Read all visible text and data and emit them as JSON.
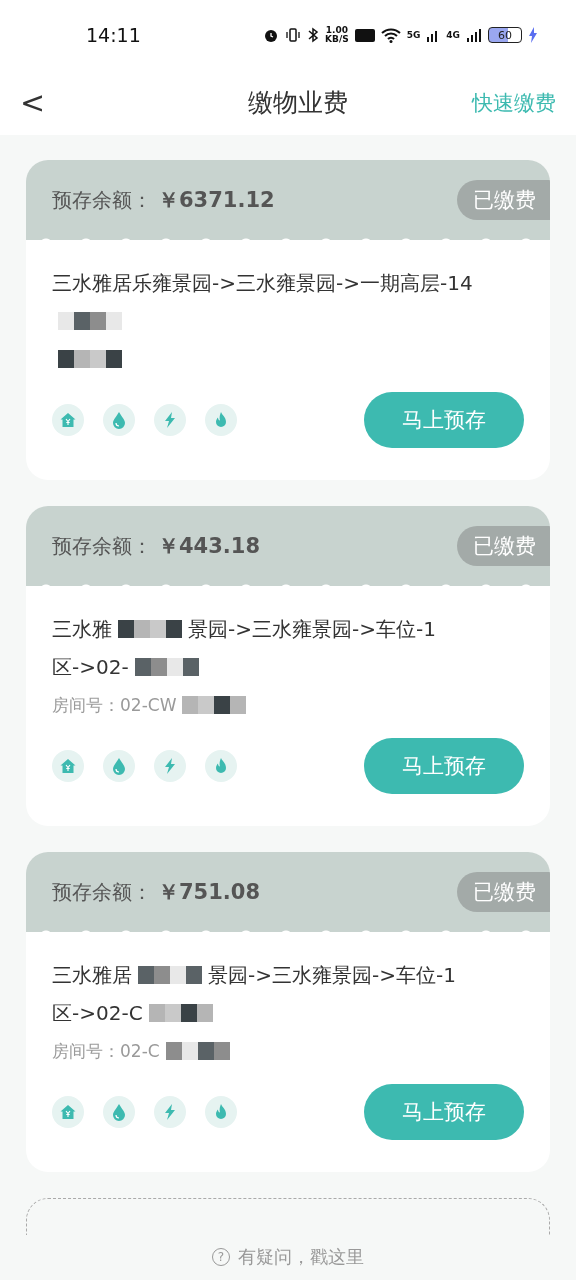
{
  "status_bar": {
    "time": "14:11",
    "net_speed_value": "1.00",
    "net_speed_unit": "KB/S",
    "network_5g": "5G",
    "network_4g": "4G",
    "battery": "60"
  },
  "header": {
    "back": "<",
    "title": "缴物业费",
    "action": "快速缴费"
  },
  "cards": [
    {
      "balance_label": "预存余额：",
      "balance": "￥6371.12",
      "status": "已缴费",
      "lines": [
        [
          {
            "kind": "text",
            "text": "三水雅居乐雍景园->三水雍景园->一期高层-14"
          }
        ],
        [
          {
            "kind": "mosaic"
          }
        ],
        [
          {
            "kind": "mosaic"
          }
        ]
      ],
      "button": "马上预存"
    },
    {
      "balance_label": "预存余额：",
      "balance": "￥443.18",
      "status": "已缴费",
      "lines": [
        [
          {
            "kind": "text",
            "text": "三水雅"
          },
          {
            "kind": "mosaic"
          },
          {
            "kind": "text",
            "text": "景园->三水雍景园->车位-1"
          }
        ],
        [
          {
            "kind": "text",
            "text": "区->02-"
          },
          {
            "kind": "mosaic"
          }
        ],
        [
          {
            "kind": "room",
            "text": "房间号：02-CW"
          },
          {
            "kind": "mosaic"
          }
        ]
      ],
      "button": "马上预存"
    },
    {
      "balance_label": "预存余额：",
      "balance": "￥751.08",
      "status": "已缴费",
      "lines": [
        [
          {
            "kind": "text",
            "text": "三水雅居"
          },
          {
            "kind": "mosaic"
          },
          {
            "kind": "text",
            "text": "景园->三水雍景园->车位-1"
          }
        ],
        [
          {
            "kind": "text",
            "text": "区->02-C"
          },
          {
            "kind": "mosaic"
          }
        ],
        [
          {
            "kind": "room",
            "text": "房间号：02-C"
          },
          {
            "kind": "mosaic"
          }
        ]
      ],
      "button": "马上预存"
    }
  ],
  "help": {
    "icon": "?",
    "text": "有疑问，戳这里"
  }
}
